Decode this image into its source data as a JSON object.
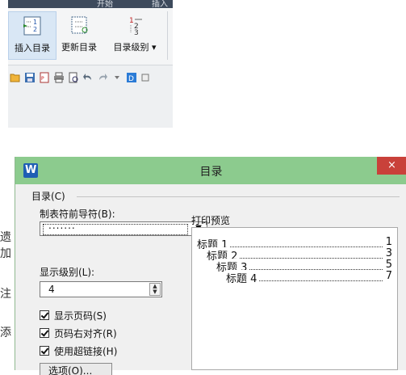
{
  "ribbon": {
    "top_tabs": [
      "开始",
      "插入"
    ],
    "buttons": [
      {
        "label": "插入目录"
      },
      {
        "label": "更新目录"
      },
      {
        "label": "目录级别 ▾"
      }
    ],
    "colors": {
      "active_button": "#d9e7f5",
      "accent": "#1f5fb4"
    }
  },
  "dialog": {
    "title": "目录",
    "app_icon": "W",
    "close_glyph": "×",
    "group_label": "目录(C)",
    "leader_label": "制表符前导符(B):",
    "leader_value": ".......",
    "level_label": "显示级别(L):",
    "level_value": "4",
    "checkboxes": [
      {
        "label": "显示页码(S)",
        "checked": true
      },
      {
        "label": "页码右对齐(R)",
        "checked": true
      },
      {
        "label": "使用超链接(H)",
        "checked": true
      }
    ],
    "preview_label": "打印预览",
    "preview_entries": [
      {
        "text": "标题 1",
        "page": "1"
      },
      {
        "text": "标题 2",
        "page": "3"
      },
      {
        "text": "标题 3",
        "page": "5"
      },
      {
        "text": "标题 4",
        "page": "7"
      }
    ],
    "options_button": "选项(O)...",
    "titlebar_color": "#8ccb8e",
    "close_color": "#c9413a"
  },
  "background_fragments": [
    "遗",
    "加",
    "注",
    "添"
  ]
}
